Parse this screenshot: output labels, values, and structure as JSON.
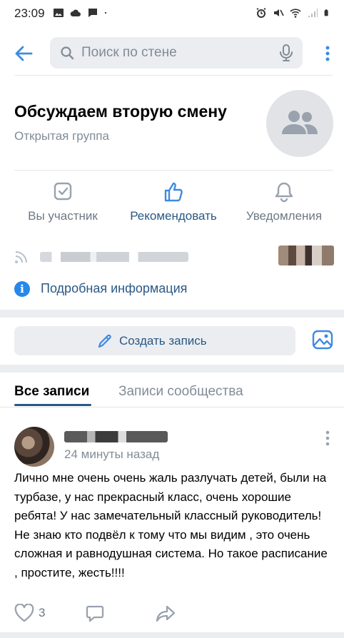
{
  "status_bar": {
    "time": "23:09",
    "left_icons": [
      "image-icon",
      "cloud-icon",
      "chat-icon",
      "dot-icon"
    ],
    "right_icons": [
      "alarm-icon",
      "mute-icon",
      "wifi-icon",
      "signal-icon",
      "battery-icon"
    ]
  },
  "search": {
    "placeholder": "Поиск по стене"
  },
  "group": {
    "title": "Обсуждаем вторую смену",
    "subtitle": "Открытая группа",
    "avatar_icon": "users-icon"
  },
  "actions": [
    {
      "label": "Вы участник",
      "icon": "checkbox-icon"
    },
    {
      "label": "Рекомендовать",
      "icon": "like-icon"
    },
    {
      "label": "Уведомления",
      "icon": "bell-icon"
    }
  ],
  "info": {
    "label": "Подробная информация"
  },
  "composer": {
    "create_label": "Создать запись"
  },
  "tabs": {
    "all": "Все записи",
    "community": "Записи сообщества"
  },
  "post": {
    "time": "24 минуты назад",
    "text": "Лично мне очень очень жаль разлучать детей, были на турбазе, у нас прекрасный класс, очень хорошие ребята! У нас замечательный классный руководитель! Не знаю кто подвёл к тому что мы видим , это очень сложная и равнодушная система. Но такое расписание , простите, жесть!!!!",
    "likes": "3"
  },
  "colors": {
    "accent": "#2a5885",
    "icon_blue": "#3f8ae0",
    "secondary_text": "#818c99",
    "surface": "#ebedf0"
  }
}
